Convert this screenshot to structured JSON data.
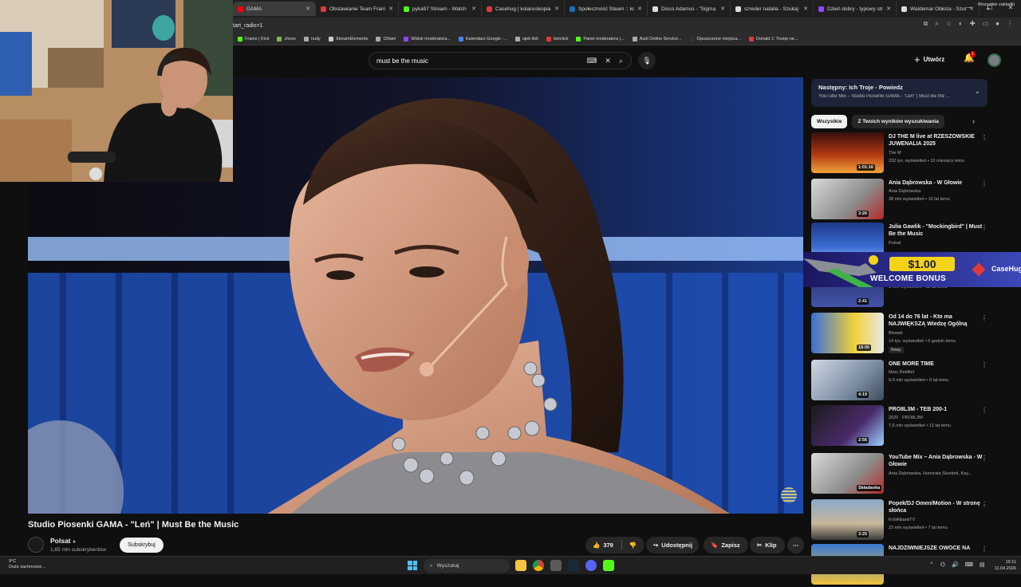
{
  "browser": {
    "tabs": [
      {
        "label": "GAMA",
        "color": "#f00",
        "active": true
      },
      {
        "label": "Obstawianie Team Franio",
        "color": "#e03a3a"
      },
      {
        "label": "pyka97 Stream - Watch L",
        "color": "#53fc18"
      },
      {
        "label": "Casehug | kolanoskopia",
        "color": "#e03a3a"
      },
      {
        "label": "Społeczność Steam :: kolo",
        "color": "#1b6db2"
      },
      {
        "label": "Disco Adamus - \"Sigma",
        "color": "#ddd"
      },
      {
        "label": "szreder natalia - Szukaj w",
        "color": "#ddd"
      },
      {
        "label": "Dzień dobry - typowy str",
        "color": "#9146ff"
      },
      {
        "label": "Waldemar Obłoza - Szuk",
        "color": "#ddd"
      }
    ],
    "new_tab": "+",
    "url": "tart_radio=1",
    "bookmarks": [
      {
        "label": "Franio | Kick",
        "color": "#53fc18"
      },
      {
        "label": "chess",
        "color": "#81b64c"
      },
      {
        "label": "nudy",
        "color": "#aaa"
      },
      {
        "label": "StreamElements",
        "color": "#ccc"
      },
      {
        "label": "Chłam",
        "color": "#aaa"
      },
      {
        "label": "Widok moderatora...",
        "color": "#9146ff"
      },
      {
        "label": "Kalendarz Google -...",
        "color": "#4285f4"
      },
      {
        "label": "ujeb link",
        "color": "#aaa"
      },
      {
        "label": "betclick",
        "color": "#e03a3a"
      },
      {
        "label": "Panel moderatora |...",
        "color": "#53fc18"
      },
      {
        "label": "Audi Online Service...",
        "color": "#aaa"
      },
      {
        "label": "Opuszczone miejsca...",
        "color": "#333"
      },
      {
        "label": "Donald J. Trump ne...",
        "color": "#e03a3a"
      }
    ],
    "all_bookmarks": "Wszystkie zakładki"
  },
  "youtube": {
    "search_query": "must be the music",
    "create_label": "Utwórz",
    "notification_count": "1",
    "video_title": "Studio Piosenki GAMA - \"Leń\" | Must Be the Music",
    "channel_name": "Polsat",
    "subscribers": "1,65 mln subskrybentów",
    "subscribe_label": "Subskrybuj",
    "likes": "379",
    "share_label": "Udostępnij",
    "save_label": "Zapisz",
    "clip_label": "Klip",
    "up_next": {
      "title": "Następny: Ich Troje - Powiedz",
      "subtitle": "YouTube Mix – Studio Piosenki GAMA - \"Leń\" | Must Be the ..."
    },
    "chips": [
      "Wszystkie",
      "Z Twoich wyników wyszukiwania"
    ],
    "recommendations": [
      {
        "title": "DJ THE M live at RZESZOWSKIE JUWENALIA 2025",
        "channel": "The M",
        "meta": "232 tys. wyświetleń • 10 miesięcy temu",
        "duration": "1:01:16",
        "thumb": "linear-gradient(180deg,#3a0d0d,#b33a12 55%,#f2a23a)"
      },
      {
        "title": "Ania Dąbrowska - W Głowie",
        "channel": "Ania Dąbrowska",
        "meta": "38 mln wyświetleń • 10 lat temu",
        "duration": "3:26",
        "thumb": "linear-gradient(135deg,#d9d9d9,#8c8c8c 60%,#b52a2a)"
      },
      {
        "title": "Julia Gawlik - \"Mockingbird\" | Must Be the Music",
        "channel": "Polsat",
        "meta": "",
        "duration": "",
        "thumb": "linear-gradient(180deg,#1d3a8a,#3b6bd1 60%,#9ac3ff)"
      },
      {
        "title": "",
        "channel": "Must Be The Music Polsat",
        "meta": "8 mln wyświetleń • 11 lat temu",
        "duration": "2:41",
        "thumb": "linear-gradient(180deg,#26306a,#4352a8)"
      },
      {
        "title": "Od 14 do 76 lat - Kto ma NAJWIĘKSZĄ Wiedzę Ogólną",
        "channel": "Blowek",
        "meta": "14 tys. wyświetleń • 6 godzin temu",
        "duration": "18:00",
        "badge": "Nowy",
        "thumb": "linear-gradient(90deg,#3a6ed8,#f0d23a 60%,#e8e8e8)"
      },
      {
        "title": "ONE MORE TIME",
        "channel": "Marc Rebillet",
        "meta": "9,9 mln wyświetleń • 6 lat temu",
        "duration": "4:19",
        "thumb": "linear-gradient(135deg,#cfd9e6,#7d8ea3 60%,#3d4b5c)"
      },
      {
        "title": "PRO8L3M - TEB 200-1",
        "channel": "2020 · PRO8L3M",
        "meta": "7,6 mln wyświetleń • 11 lat temu",
        "duration": "2:56",
        "thumb": "linear-gradient(135deg,#1a1a1a,#4a2a6a 60%,#9ad1ff)"
      },
      {
        "title": "YouTube Mix – Ania Dąbrowska - W Głowie",
        "channel": "Ania Dąbrowska, Honorata Skarbek, Kay...",
        "meta": "",
        "duration": "Składanka",
        "thumb": "linear-gradient(135deg,#d9d9d9,#8c8c8c 60%,#b52a2a)"
      },
      {
        "title": "Popek/DJ Omen/Motion - W stronę słońca",
        "channel": "KrólAlbaniiTV",
        "meta": "23 mln wyświetleń • 7 lat temu",
        "duration": "3:25",
        "thumb": "linear-gradient(180deg,#8aa9c9,#c7b79a 60%,#3b3b3b)"
      },
      {
        "title": "NAJDZIWNIEJSZE OWOCE NA",
        "channel": "",
        "meta": "",
        "duration": "",
        "thumb": "linear-gradient(180deg,#3a7ad1,#f2c23a)"
      }
    ]
  },
  "ad": {
    "amount": "$1.00",
    "headline": "WELCOME BONUS",
    "brand": "CaseHug"
  },
  "taskbar": {
    "weather_temp": "9°C",
    "weather_desc": "Duże zachmurze...",
    "search_label": "Wyszukaj",
    "time": "16:11",
    "date": "11.04.2026"
  }
}
